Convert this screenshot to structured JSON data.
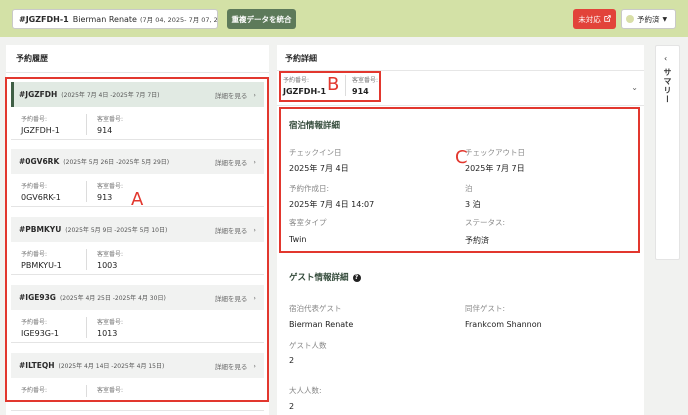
{
  "header": {
    "booking_code": "#JGZFDH-1",
    "guest_name": "Bierman Renate",
    "date_range": "(7月 04, 2025- 7月 07, 2025)",
    "merge_label": "重複データを統合",
    "unhandled_label": "未対応",
    "status_label": "予約済",
    "colors": {
      "topbar": "#d3e1a6",
      "merge": "#5d7a5a",
      "unhandled": "#e2433a"
    }
  },
  "history": {
    "title": "予約履歴",
    "link_label": "詳細を見る",
    "booking_no_label": "予約番号:",
    "room_no_label": "客室番号:",
    "cards": [
      {
        "code": "#JGZFDH",
        "range": "(2025年 7月 4日 -2025年 7月 7日)",
        "booking_no": "JGZFDH-1",
        "room_no": "914"
      },
      {
        "code": "#0GV6RK",
        "range": "(2025年 5月 26日 -2025年 5月 29日)",
        "booking_no": "0GV6RK-1",
        "room_no": "913"
      },
      {
        "code": "#PBMKYU",
        "range": "(2025年 5月 9日 -2025年 5月 10日)",
        "booking_no": "PBMKYU-1",
        "room_no": "1003"
      },
      {
        "code": "#IGE93G",
        "range": "(2025年 4月 25日 -2025年 4月 30日)",
        "booking_no": "IGE93G-1",
        "room_no": "1013"
      },
      {
        "code": "#ILTEQH",
        "range": "(2025年 4月 14日 -2025年 4月 15日)",
        "booking_no": "",
        "room_no": ""
      }
    ]
  },
  "detail": {
    "title": "予約詳細",
    "booking_no_label": "予約番号:",
    "booking_no": "JGZFDH-1",
    "room_no_label": "客室番号:",
    "room_no": "914",
    "stay": {
      "title": "宿泊情報詳細",
      "checkin_label": "チェックイン日",
      "checkin": "2025年 7月 4日",
      "checkout_label": "チェックアウト日",
      "checkout": "2025年 7月 7日",
      "created_label": "予約作成日:",
      "created": "2025年 7月 4日 14:07",
      "nights_label": "泊",
      "nights": "3 泊",
      "room_type_label": "客室タイプ",
      "room_type": "Twin",
      "status_label": "ステータス:",
      "status": "予約済"
    },
    "guest": {
      "title": "ゲスト情報詳細",
      "lead_label": "宿泊代表ゲスト",
      "lead": "Bierman Renate",
      "companion_label": "同伴ゲスト:",
      "companion": "Frankcom Shannon",
      "guest_count_label": "ゲスト人数",
      "guest_count": "2",
      "adult_count_label": "大人人数:",
      "adult_count": "2"
    }
  },
  "summary_label": "サマリー",
  "annotations": {
    "a": "A",
    "b": "B",
    "c": "C"
  }
}
